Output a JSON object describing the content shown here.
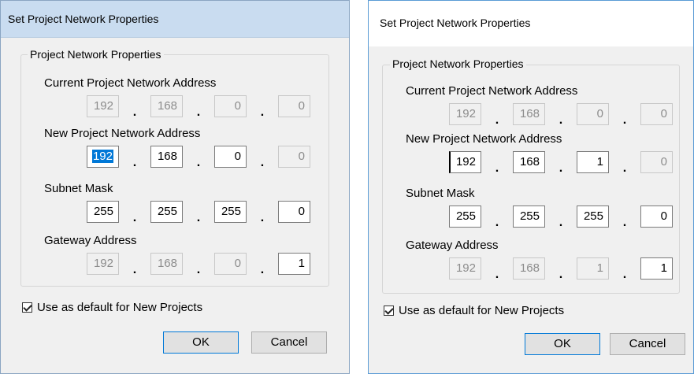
{
  "dialogs": [
    {
      "title": "Set Project Network Properties",
      "group_label": "Project Network Properties",
      "current": {
        "label": "Current Project Network Address",
        "octets": [
          "192",
          "168",
          "0",
          "0"
        ]
      },
      "new": {
        "label": "New Project Network Address",
        "octets": [
          "192",
          "168",
          "0",
          "0"
        ]
      },
      "subnet": {
        "label": "Subnet Mask",
        "octets": [
          "255",
          "255",
          "255",
          "0"
        ]
      },
      "gateway": {
        "label": "Gateway Address",
        "octets": [
          "192",
          "168",
          "0",
          "1"
        ]
      },
      "checkbox": {
        "label": "Use as default for New Projects",
        "checked": true
      },
      "ok_label": "OK",
      "cancel_label": "Cancel"
    },
    {
      "title": "Set Project Network Properties",
      "group_label": "Project Network Properties",
      "current": {
        "label": "Current Project Network Address",
        "octets": [
          "192",
          "168",
          "0",
          "0"
        ]
      },
      "new": {
        "label": "New Project Network Address",
        "octets": [
          "192",
          "168",
          "1",
          "0"
        ]
      },
      "subnet": {
        "label": "Subnet Mask",
        "octets": [
          "255",
          "255",
          "255",
          "0"
        ]
      },
      "gateway": {
        "label": "Gateway Address",
        "octets": [
          "192",
          "168",
          "1",
          "1"
        ]
      },
      "checkbox": {
        "label": "Use as default for New Projects",
        "checked": true
      },
      "ok_label": "OK",
      "cancel_label": "Cancel"
    }
  ]
}
